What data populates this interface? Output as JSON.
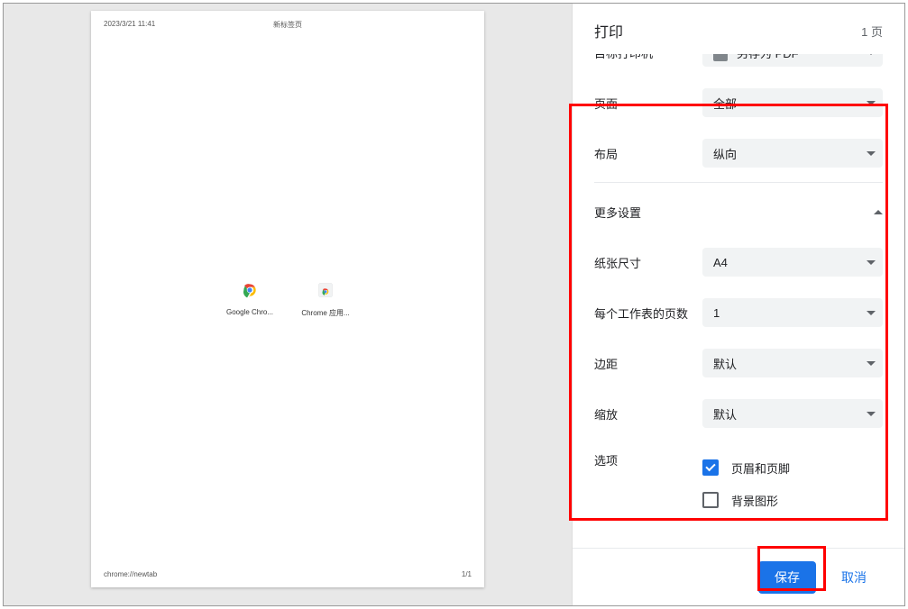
{
  "dialog": {
    "title": "打印",
    "sheet_count": "1 页"
  },
  "preview": {
    "header_left": "2023/3/21 11:41",
    "header_center": "新标签页",
    "footer_left": "chrome://newtab",
    "footer_right": "1/1",
    "shortcuts": [
      {
        "label": "Google Chro..."
      },
      {
        "label": "Chrome 应用..."
      }
    ]
  },
  "settings": {
    "destination": {
      "label": "目标打印机",
      "value": "另存为 PDF"
    },
    "pages": {
      "label": "页面",
      "value": "全部"
    },
    "layout": {
      "label": "布局",
      "value": "纵向"
    },
    "more_settings_label": "更多设置",
    "paper_size": {
      "label": "纸张尺寸",
      "value": "A4"
    },
    "pages_per_sheet": {
      "label": "每个工作表的页数",
      "value": "1"
    },
    "margins": {
      "label": "边距",
      "value": "默认"
    },
    "scale": {
      "label": "缩放",
      "value": "默认"
    },
    "options": {
      "label": "选项",
      "headers_footers": {
        "label": "页眉和页脚",
        "checked": true
      },
      "background_graphics": {
        "label": "背景图形",
        "checked": false
      }
    }
  },
  "footer": {
    "save": "保存",
    "cancel": "取消"
  }
}
